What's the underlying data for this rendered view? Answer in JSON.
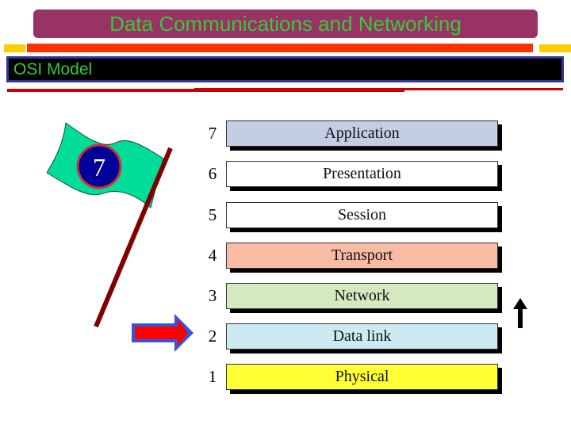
{
  "header": {
    "title": "Data Communications and Networking",
    "subtitle": "OSI Model"
  },
  "colors": {
    "title_bg": "#993366",
    "title_text": "#33cc33",
    "accent_red": "#ff3300",
    "accent_yellow": "#ffcc00",
    "subtitle_bg": "#000000",
    "subtitle_border": "#333399"
  },
  "flag": {
    "badge_number": "7",
    "flag_color": "#00dd99",
    "badge_color": "#000099",
    "badge_ring": "#cc3333",
    "pole_color": "#800000"
  },
  "layers": [
    {
      "number": "7",
      "name": "Application",
      "color": "#c3cde3"
    },
    {
      "number": "6",
      "name": "Presentation",
      "color": "#ffffff"
    },
    {
      "number": "5",
      "name": "Session",
      "color": "#ffffff"
    },
    {
      "number": "4",
      "name": "Transport",
      "color": "#f8bba3"
    },
    {
      "number": "3",
      "name": "Network",
      "color": "#d4e9c0"
    },
    {
      "number": "2",
      "name": "Data link",
      "color": "#cceaf2"
    },
    {
      "number": "1",
      "name": "Physical",
      "color": "#ffff33"
    }
  ],
  "pointer": {
    "icon": "right-arrow-icon",
    "points_to_layer": "2"
  },
  "direction_indicator": {
    "icon": "up-arrow-icon"
  }
}
